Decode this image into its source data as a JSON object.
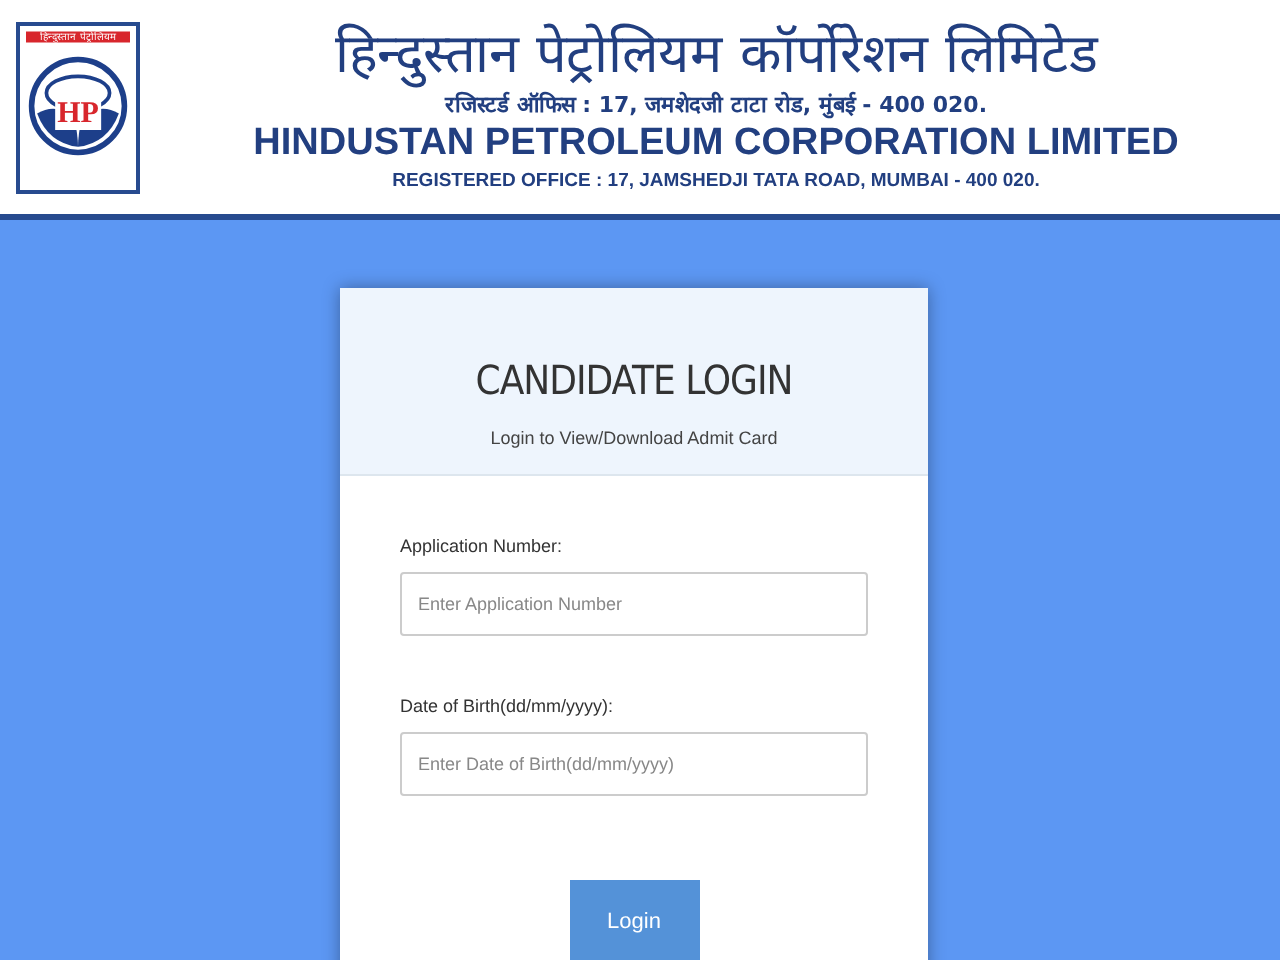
{
  "header": {
    "logo": {
      "strip_text": "हिन्दुस्तान पेट्रोलियम",
      "mark": "HP"
    },
    "title_hindi": "हिन्दुस्तान पेट्रोलियम कॉर्पोरेशन लिमिटेड",
    "address_hindi": "रजिस्टर्ड ऑफिस : 17, जमशेदजी टाटा रोड, मुंबई - 400 020.",
    "title": "HINDUSTAN PETROLEUM CORPORATION LIMITED",
    "address": "REGISTERED OFFICE : 17, JAMSHEDJI TATA ROAD, MUMBAI - 400 020."
  },
  "login": {
    "title": "CANDIDATE LOGIN",
    "subtitle": "Login to View/Download Admit Card",
    "fields": [
      {
        "label": "Application Number:",
        "placeholder": "Enter Application Number"
      },
      {
        "label": "Date of Birth(dd/mm/yyyy):",
        "placeholder": "Enter Date of Birth(dd/mm/yyyy)"
      }
    ],
    "button": "Login"
  }
}
